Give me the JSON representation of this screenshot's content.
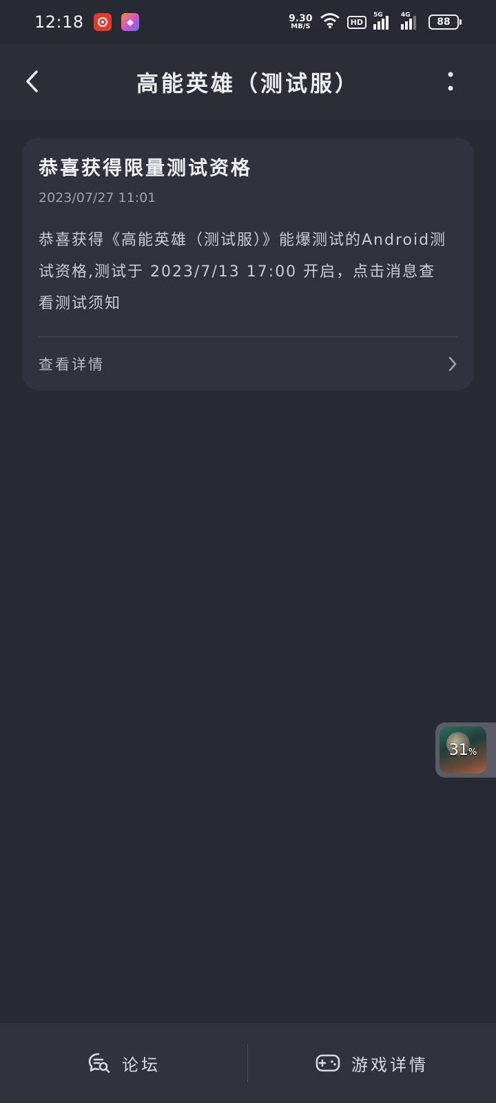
{
  "status_bar": {
    "time": "12:18",
    "net_speed_value": "9.30",
    "net_speed_unit": "MB/S",
    "hd_label": "HD",
    "signal1_label": "5G",
    "signal2_label": "4G",
    "battery": "88"
  },
  "app_bar": {
    "title": "高能英雄（测试服）"
  },
  "card": {
    "title": "恭喜获得限量测试资格",
    "date": "2023/07/27 11:01",
    "body": "恭喜获得《高能英雄（测试服）》能爆测试的Android测试资格,测试于 2023/7/13 17:00 开启，点击消息查看测试须知",
    "link_label": "查看详情"
  },
  "floating": {
    "percent": "31",
    "percent_sign": "%"
  },
  "bottom_bar": {
    "forum_label": "论坛",
    "game_details_label": "游戏详情"
  },
  "colors": {
    "background": "#282a33",
    "card": "#30323d",
    "text_primary": "#f0f1f4",
    "text_secondary": "#9ea2ad"
  }
}
